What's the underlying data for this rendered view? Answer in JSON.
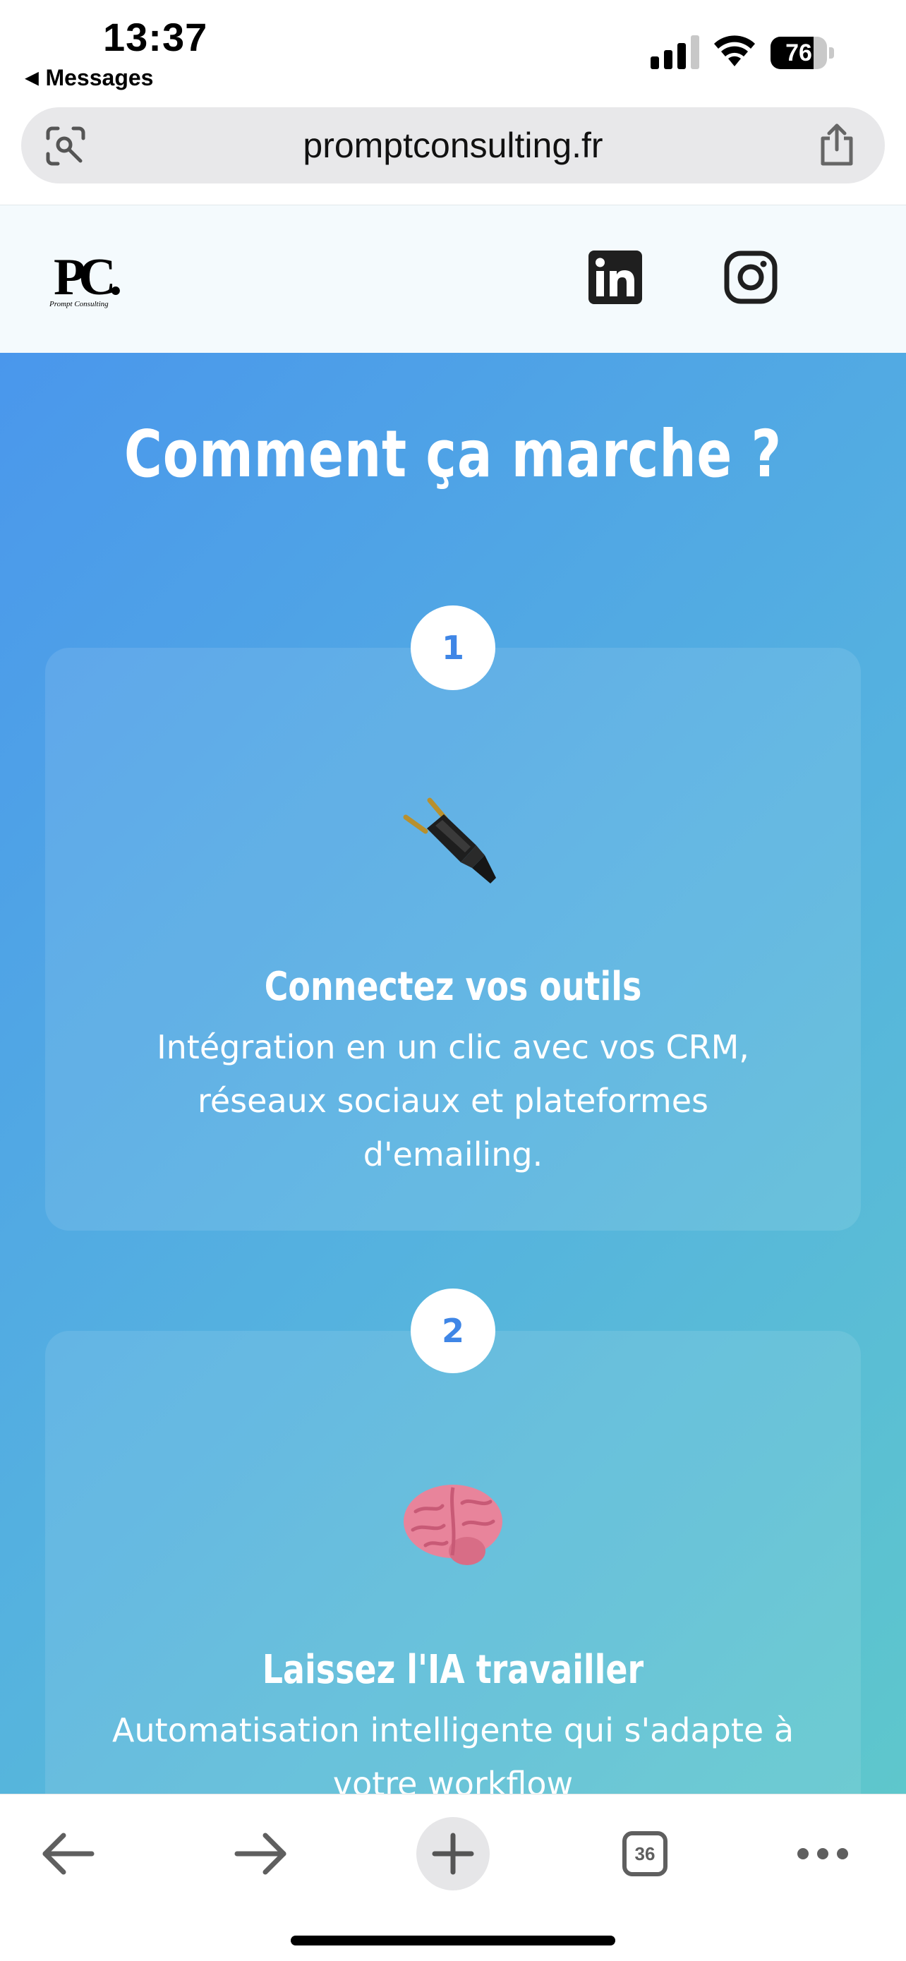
{
  "status_bar": {
    "time": "13:37",
    "back_label": "Messages",
    "battery_level": "76",
    "battery_fraction": 0.76
  },
  "address_bar": {
    "url": "promptconsulting.fr"
  },
  "site_header": {
    "logo_text": "PC.",
    "logo_tagline": "Prompt Consulting",
    "social_icons": [
      "linkedin-icon",
      "instagram-icon"
    ]
  },
  "main": {
    "section_title": "Comment ça marche ?",
    "steps": [
      {
        "number": "1",
        "icon": "electric-plug-emoji",
        "emoji": "🔌",
        "title": "Connectez vos outils",
        "description": "Intégration en un clic avec vos CRM, réseaux sociaux et plateformes d'emailing."
      },
      {
        "number": "2",
        "icon": "brain-emoji",
        "emoji": "🧠",
        "title": "Laissez l'IA travailler",
        "description": "Automatisation intelligente qui s'adapte à votre workflow"
      }
    ]
  },
  "toolbar": {
    "tab_count": "36",
    "buttons": [
      "back-arrow-icon",
      "forward-arrow-icon",
      "new-tab-plus-icon",
      "tabs-icon",
      "more-icon"
    ]
  },
  "colors": {
    "gradient_start": "#4a97ec",
    "gradient_end": "#5ec7cc",
    "badge_number": "#3f86e6",
    "header_bg": "#f4fafd"
  }
}
